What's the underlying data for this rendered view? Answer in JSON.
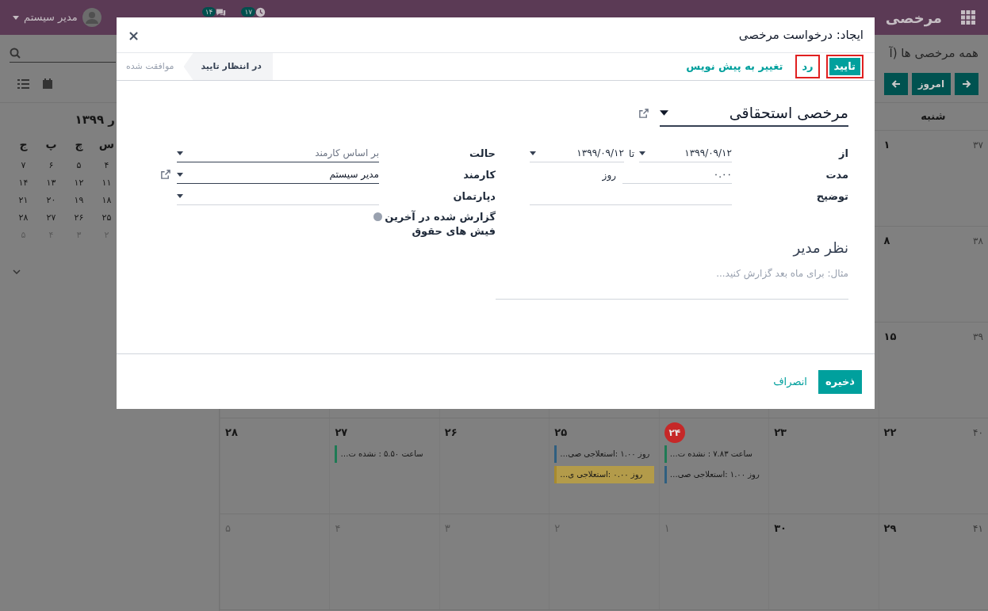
{
  "navbar": {
    "app_name": "مرخصی",
    "user": "مدیر سیستم",
    "counters": [
      {
        "kind": "activity",
        "count": "۱۷"
      },
      {
        "kind": "messages",
        "count": "۱۴"
      }
    ]
  },
  "control_panel": {
    "breadcrumb": "همه مرخصی ها (آ",
    "today_button": "امروز"
  },
  "mini_calendar": {
    "title": "ر ۱۳۹۹",
    "weekdays": [
      "س",
      "چ",
      "پ",
      "ج"
    ],
    "weeks": [
      [
        {
          "day": "۴",
          "muted": false
        },
        {
          "day": "۵",
          "muted": false
        },
        {
          "day": "۶",
          "muted": false
        },
        {
          "day": "۷",
          "muted": false
        }
      ],
      [
        {
          "day": "۱۱",
          "muted": false
        },
        {
          "day": "۱۲",
          "muted": false
        },
        {
          "day": "۱۳",
          "muted": false
        },
        {
          "day": "۱۴",
          "muted": false
        }
      ],
      [
        {
          "day": "۱۸",
          "muted": false
        },
        {
          "day": "۱۹",
          "muted": false
        },
        {
          "day": "۲۰",
          "muted": false
        },
        {
          "day": "۲۱",
          "muted": false
        }
      ],
      [
        {
          "day": "۲۵",
          "muted": false
        },
        {
          "day": "۲۶",
          "muted": false
        },
        {
          "day": "۲۷",
          "muted": false
        },
        {
          "day": "۲۸",
          "muted": false
        }
      ],
      [
        {
          "day": "۲",
          "muted": true
        },
        {
          "day": "۳",
          "muted": true
        },
        {
          "day": "۴",
          "muted": true
        },
        {
          "day": "۵",
          "muted": true
        }
      ]
    ]
  },
  "calendar": {
    "weekday": "شنبه",
    "weeks": [
      {
        "week": "۳۷",
        "days": [
          {
            "day": "۱",
            "muted": false,
            "today": false
          }
        ]
      },
      {
        "week": "۳۸",
        "days": [
          {
            "day": "۸",
            "muted": false,
            "today": false
          }
        ]
      },
      {
        "week": "۳۹",
        "days": [
          {
            "day": "۱۵",
            "muted": false,
            "today": false
          }
        ]
      },
      {
        "week": "۴۰",
        "days": [
          {
            "day": "۲۲",
            "muted": false,
            "today": false
          },
          {
            "day": "۲۳",
            "muted": false,
            "today": false
          },
          {
            "day": "۲۴",
            "muted": false,
            "today": true,
            "events": [
              {
                "text": "ساعت ۷.۸۳ : نشده ت…",
                "color": "#1e7a54",
                "highlighted": false
              },
              {
                "text": "روز ۱.۰۰ :استعلاجی صی…",
                "color": "#2f5f80",
                "highlighted": false
              }
            ]
          },
          {
            "day": "۲۵",
            "muted": false,
            "today": false,
            "events": [
              {
                "text": "روز ۱.۰۰ :استعلاجی صی…",
                "color": "#2f5f80",
                "highlighted": false
              },
              {
                "text": "روز ۰.۰۰ :استعلاجی ی…",
                "color": "#a88a2e",
                "highlighted": true
              }
            ]
          },
          {
            "day": "۲۶",
            "muted": false,
            "today": false
          },
          {
            "day": "۲۷",
            "muted": false,
            "today": false,
            "events": [
              {
                "text": "ساعت ۵.۵۰ : نشده ت…",
                "color": "#1e7a54",
                "highlighted": false
              }
            ]
          },
          {
            "day": "۲۸",
            "muted": false,
            "today": false
          }
        ]
      },
      {
        "week": "۴۱",
        "days": [
          {
            "day": "۲۹",
            "muted": false,
            "today": false
          },
          {
            "day": "۳۰",
            "muted": false,
            "today": false
          },
          {
            "day": "۱",
            "muted": true,
            "today": false
          },
          {
            "day": "۲",
            "muted": true,
            "today": false
          },
          {
            "day": "۳",
            "muted": true,
            "today": false
          },
          {
            "day": "۴",
            "muted": true,
            "today": false
          },
          {
            "day": "۵",
            "muted": true,
            "today": false
          }
        ]
      }
    ]
  },
  "dialog": {
    "title": "ایجاد: درخواست مرخصی",
    "close": "×",
    "actions": [
      {
        "label": "تایید",
        "kind": "primary",
        "highlighted": true
      },
      {
        "label": "رد",
        "kind": "secondary",
        "highlighted": true
      },
      {
        "label": "تغییر به پیش نویس",
        "kind": "link",
        "highlighted": false
      }
    ],
    "stages": [
      {
        "label": "در انتظار تایید",
        "selected": true
      },
      {
        "label": "موافقت شده",
        "selected": false
      }
    ],
    "leave_type": "مرخصی استحقاقی",
    "fields": {
      "from": {
        "label": "از",
        "start": "۱۳۹۹/۰۹/۱۲",
        "separator": "تا",
        "end": "۱۳۹۹/۰۹/۱۲"
      },
      "duration": {
        "label": "مدت",
        "value": "۰.۰۰",
        "unit": "روز"
      },
      "description": {
        "label": "توضیح"
      },
      "mode": {
        "label": "حالت",
        "value": "بر اساس کارمند"
      },
      "employee": {
        "label": "کارمند",
        "value": "مدیر سیستم"
      },
      "department": {
        "label": "دپارتمان"
      },
      "reported": {
        "label": "گزارش شده در آخرین فیش های حقوق",
        "checked": false
      }
    },
    "manager_note": {
      "heading": "نظر مدیر",
      "placeholder": "مثال: برای ماه بعد گزارش کنید..."
    },
    "footer": [
      {
        "label": "ذخیره",
        "kind": "primary"
      },
      {
        "label": "انصراف",
        "kind": "link"
      }
    ]
  }
}
